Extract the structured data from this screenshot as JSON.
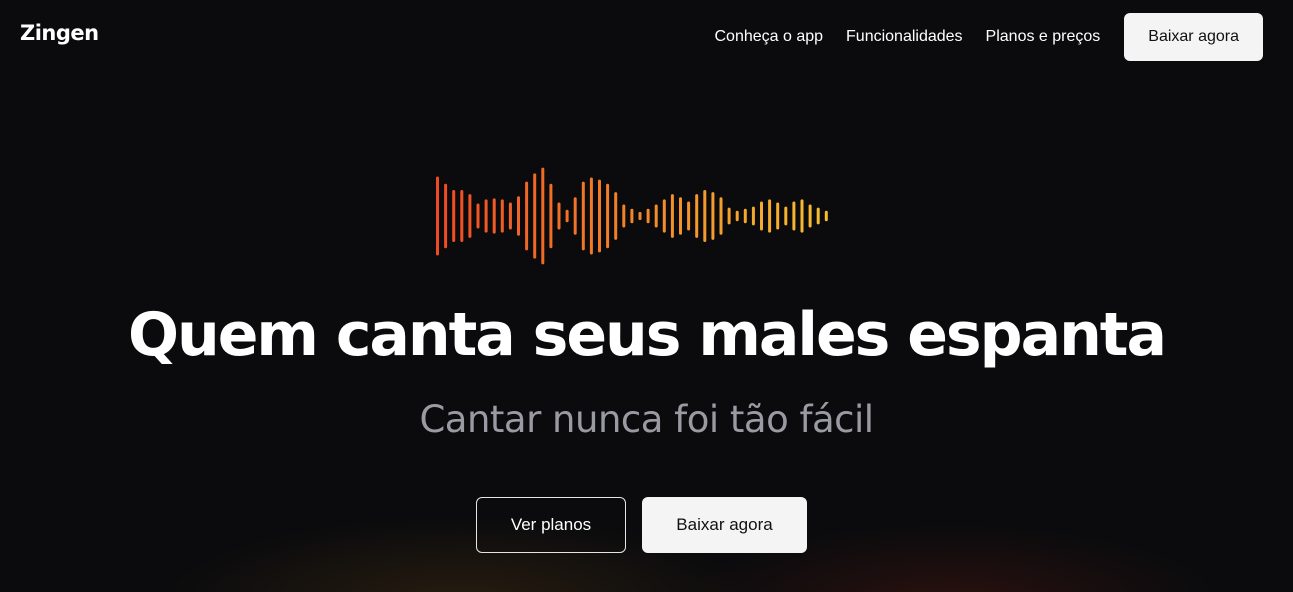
{
  "brand": {
    "name": "Zingen"
  },
  "nav": {
    "links": [
      "Conheça o app",
      "Funcionalidades",
      "Planos e preços"
    ],
    "cta_label": "Baixar agora"
  },
  "hero": {
    "title": "Quem canta seus males espanta",
    "subtitle": "Cantar nunca foi tão fácil",
    "secondary_button": "Ver planos",
    "primary_button": "Baixar agora"
  },
  "waveform": {
    "icon": "audio-waveform-icon",
    "gradient_start": "#f04a23",
    "gradient_end": "#f5c030",
    "levels": [
      0.76,
      0.62,
      0.5,
      0.5,
      0.42,
      0.24,
      0.32,
      0.34,
      0.32,
      0.26,
      0.38,
      0.66,
      0.82,
      0.93,
      0.62,
      0.26,
      0.12,
      0.36,
      0.66,
      0.74,
      0.7,
      0.62,
      0.46,
      0.22,
      0.14,
      0.08,
      0.14,
      0.22,
      0.32,
      0.42,
      0.36,
      0.28,
      0.42,
      0.5,
      0.46,
      0.36,
      0.16,
      0.1,
      0.14,
      0.18,
      0.28,
      0.32,
      0.26,
      0.18,
      0.28,
      0.32,
      0.22,
      0.16,
      0.1
    ]
  }
}
